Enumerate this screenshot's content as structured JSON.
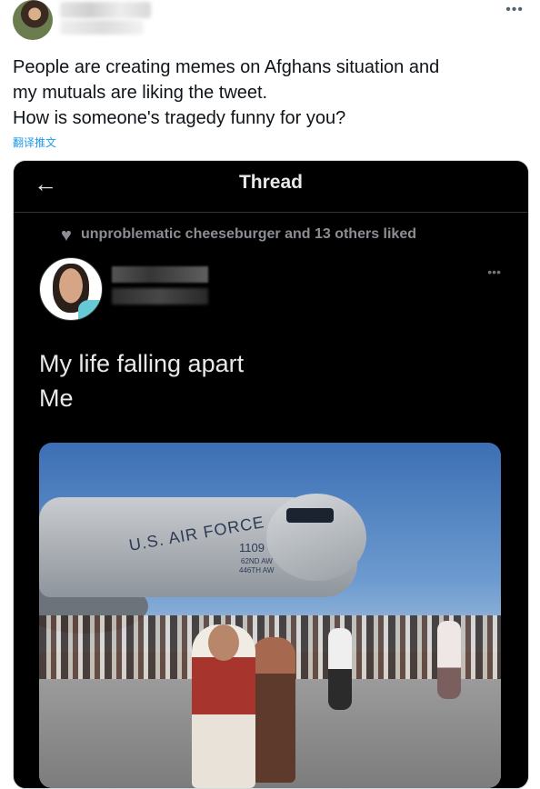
{
  "tweet": {
    "more_label": "•••",
    "text_lines": [
      "People are creating memes on Afghans situation and",
      "my mutuals are liking the tweet.",
      "How is someone's tragedy funny for you?"
    ],
    "translate_label": "翻译推文"
  },
  "quoted_screenshot": {
    "back_icon": "←",
    "title": "Thread",
    "heart_icon": "♥",
    "liked_text": "unproblematic cheeseburger and 13 others liked",
    "more_label": "•••",
    "post_lines": [
      "My life falling apart",
      "Me"
    ],
    "media": {
      "plane_label": "U.S. AIR FORCE",
      "tail_number": "1109",
      "sub_label_1": "62ND AW",
      "sub_label_2": "446TH AW"
    }
  },
  "colors": {
    "link": "#1d9bf0",
    "dark_bg": "#000000",
    "dark_text": "#e7e9ea",
    "muted": "#8b8f94"
  }
}
